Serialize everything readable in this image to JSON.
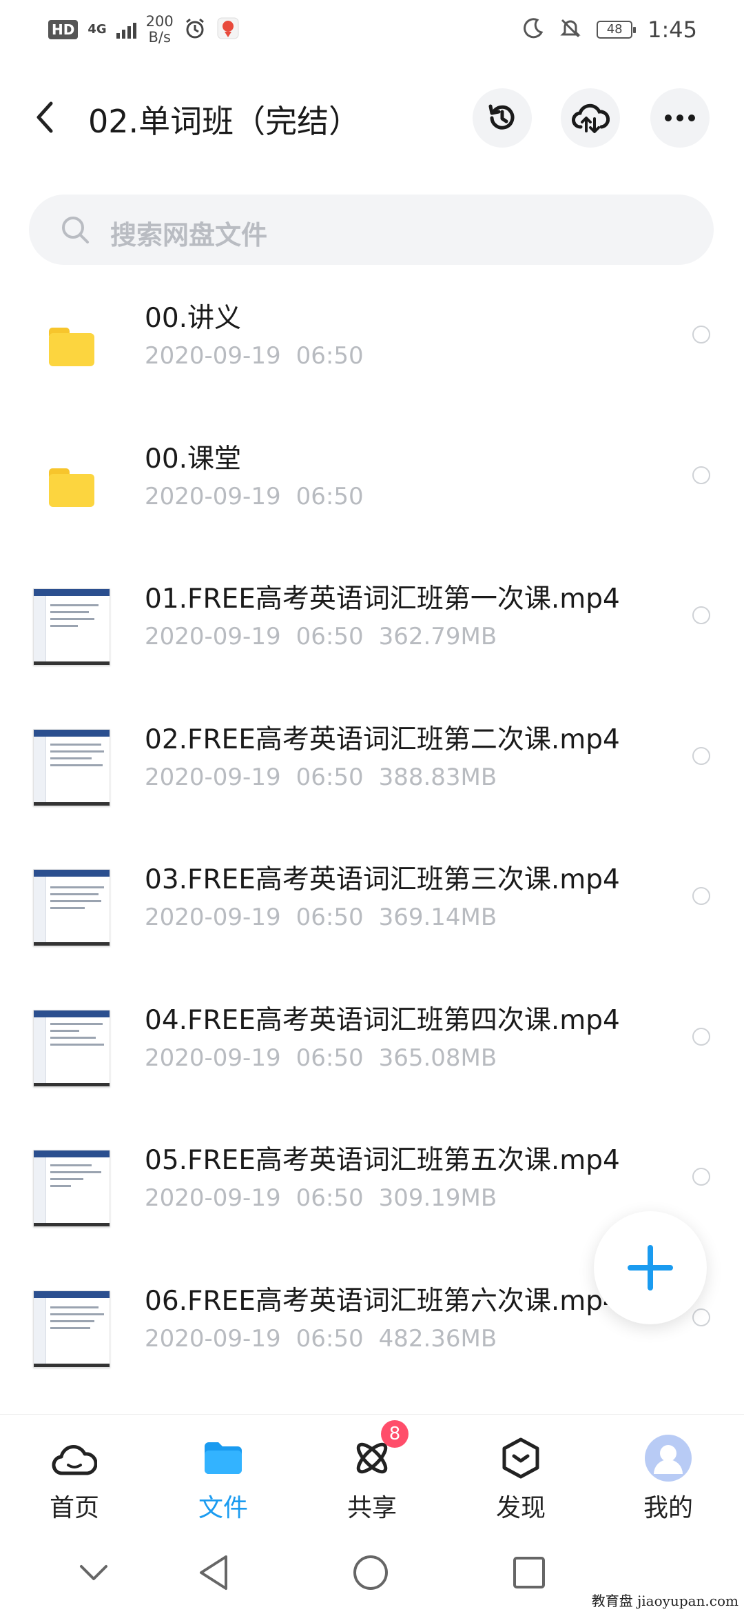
{
  "status_bar": {
    "hd": "HD",
    "network": "4G",
    "speed_value": "200",
    "speed_unit": "B/s",
    "battery": "48",
    "time": "1:45"
  },
  "header": {
    "title": "02.单词班（完结）"
  },
  "search": {
    "placeholder": "搜索网盘文件"
  },
  "files": [
    {
      "name": "00.讲义",
      "date": "2020-09-19",
      "time": "06:50",
      "size": "",
      "type": "folder"
    },
    {
      "name": "00.课堂",
      "date": "2020-09-19",
      "time": "06:50",
      "size": "",
      "type": "folder"
    },
    {
      "name": "01.FREE高考英语词汇班第一次课.mp4",
      "date": "2020-09-19",
      "time": "06:50",
      "size": "362.79MB",
      "type": "video"
    },
    {
      "name": "02.FREE高考英语词汇班第二次课.mp4",
      "date": "2020-09-19",
      "time": "06:50",
      "size": "388.83MB",
      "type": "video"
    },
    {
      "name": "03.FREE高考英语词汇班第三次课.mp4",
      "date": "2020-09-19",
      "time": "06:50",
      "size": "369.14MB",
      "type": "video"
    },
    {
      "name": "04.FREE高考英语词汇班第四次课.mp4",
      "date": "2020-09-19",
      "time": "06:50",
      "size": "365.08MB",
      "type": "video"
    },
    {
      "name": "05.FREE高考英语词汇班第五次课.mp4",
      "date": "2020-09-19",
      "time": "06:50",
      "size": "309.19MB",
      "type": "video"
    },
    {
      "name": "06.FREE高考英语词汇班第六次课.mp4",
      "date": "2020-09-19",
      "time": "06:50",
      "size": "482.36MB",
      "type": "video"
    }
  ],
  "bottom_nav": {
    "home": "首页",
    "files": "文件",
    "share": "共享",
    "share_badge": "8",
    "discover": "发现",
    "mine": "我的"
  },
  "colors": {
    "accent": "#1a9bf0",
    "folder": "#fcd53f",
    "badge": "#ff4d6a"
  },
  "watermark": "教育盘 jiaoyupan.com"
}
